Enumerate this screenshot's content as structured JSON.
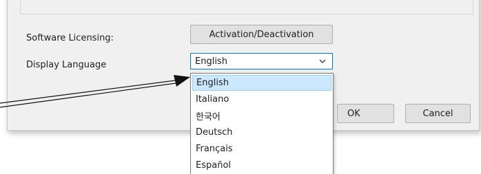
{
  "settings": {
    "software_licensing_label": "Software Licensing:",
    "activation_button": "Activation/Deactivation",
    "display_language_label": "Display Language",
    "selected_language": "English"
  },
  "dropdown": {
    "options": [
      "English",
      "Italiano",
      "한국어",
      "Deutsch",
      "Français",
      "Español"
    ],
    "highlighted_index": 0
  },
  "footer": {
    "ok_label": "OK",
    "cancel_label": "Cancel"
  },
  "icons": {
    "combo_arrow": "chevron-down-icon",
    "callout": "arrow-pointer-icon"
  },
  "colors": {
    "focus_border": "#0078d7",
    "highlight_bg": "#cce8ff"
  }
}
